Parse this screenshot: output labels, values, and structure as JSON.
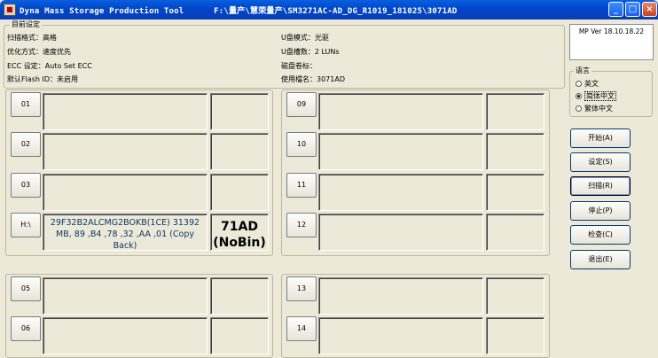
{
  "window": {
    "title": "Dyna Mass Storage Production Tool      F:\\量产\\慧荣量产\\SM3271AC-AD_DG_R1019_181025\\3071AD",
    "controls": {
      "minimize": "_",
      "maximize": "□",
      "close": "×"
    }
  },
  "settings": {
    "group_label": "目前设定",
    "scan_format": "扫描格式：高格",
    "optimize_mode": "优化方式：速度优先",
    "ecc_setting": "ECC 设定：Auto Set ECC",
    "default_flash_id": "默认Flash ID：未启用",
    "udisk_mode": "U盘模式：光驱",
    "udisk_count": "U盘槽数：2 LUNs",
    "disk_label": "磁盘卷标：",
    "template_name": "使用檔名：3071AD"
  },
  "version": "MP Ver 18.10.18.22",
  "language": {
    "label": "语言",
    "options": [
      "英文",
      "简体中文",
      "繁体中文"
    ],
    "selected": "简体中文"
  },
  "actions": {
    "start": "开始(A)",
    "settings": "设定(S)",
    "scan": "扫描(R)",
    "stop": "停止(P)",
    "check": "检查(C)",
    "exit": "退出(E)"
  },
  "ports": {
    "p01": "01",
    "p02": "02",
    "p03": "03",
    "p04": "H:\\",
    "p04_info": "29F32B2ALCMG2BOKB(1CE) 31392 MB, 89 ,B4 ,78 ,32 ,AA ,01  (Copy Back)",
    "p04_model": "71AD (NoBin)",
    "p05": "05",
    "p06": "06",
    "p09": "09",
    "p10": "10",
    "p11": "11",
    "p12": "12",
    "p13": "13",
    "p14": "14"
  }
}
